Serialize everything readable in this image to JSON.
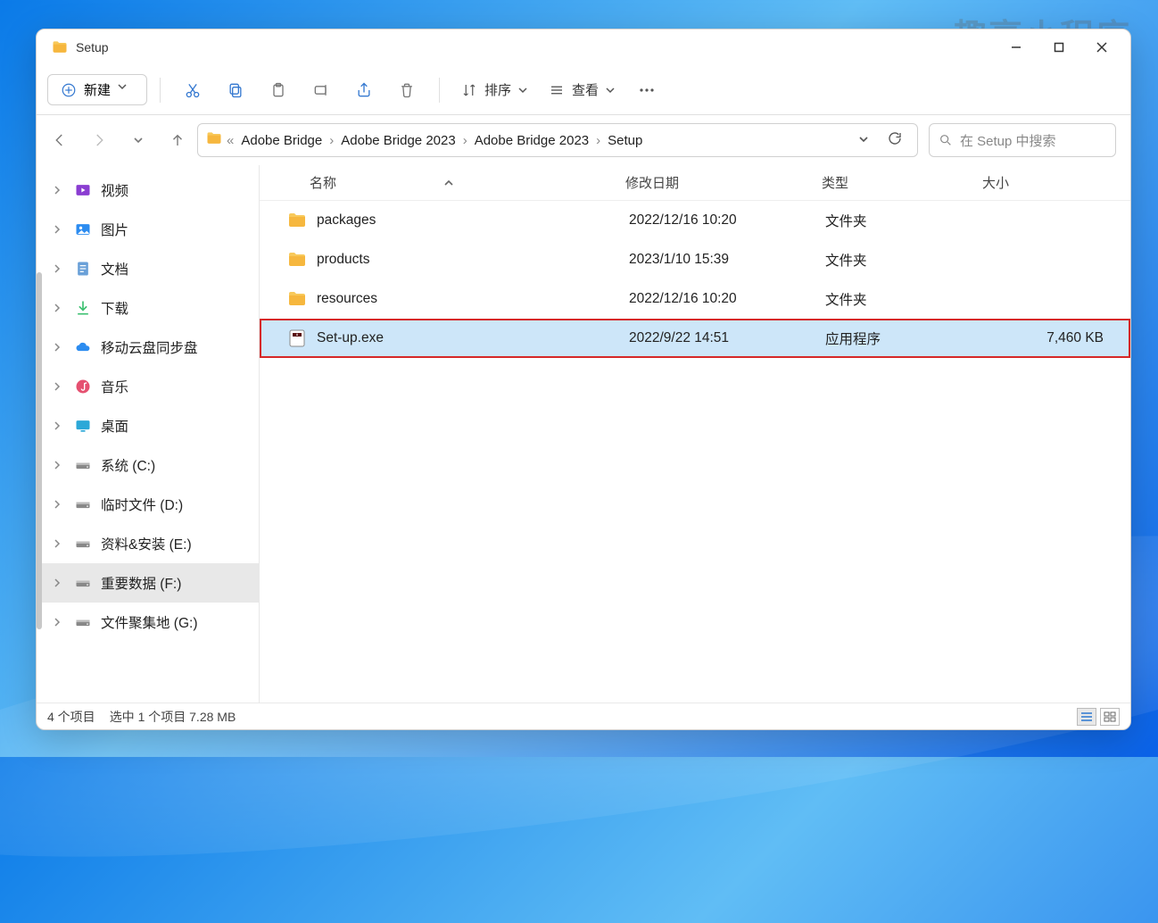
{
  "window_title": "Setup",
  "toolbar": {
    "new_label": "新建",
    "sort_label": "排序",
    "view_label": "查看"
  },
  "breadcrumb": [
    "Adobe Bridge",
    "Adobe Bridge 2023",
    "Adobe Bridge 2023",
    "Setup"
  ],
  "search_placeholder": "在 Setup 中搜索",
  "columns": {
    "name": "名称",
    "date": "修改日期",
    "type": "类型",
    "size": "大小"
  },
  "files": [
    {
      "icon": "folder",
      "name": "packages",
      "date": "2022/12/16 10:20",
      "type": "文件夹",
      "size": ""
    },
    {
      "icon": "folder",
      "name": "products",
      "date": "2023/1/10 15:39",
      "type": "文件夹",
      "size": ""
    },
    {
      "icon": "folder",
      "name": "resources",
      "date": "2022/12/16 10:20",
      "type": "文件夹",
      "size": ""
    },
    {
      "icon": "exe",
      "name": "Set-up.exe",
      "date": "2022/9/22 14:51",
      "type": "应用程序",
      "size": "7,460 KB",
      "selected": true
    }
  ],
  "sidebar": [
    {
      "icon": "video",
      "label": "视频",
      "color": "#8a3dd1"
    },
    {
      "icon": "picture",
      "label": "图片",
      "color": "#2c8cf0"
    },
    {
      "icon": "doc",
      "label": "文档",
      "color": "#6aa0d8"
    },
    {
      "icon": "download",
      "label": "下载",
      "color": "#3cc070"
    },
    {
      "icon": "cloud",
      "label": "移动云盘同步盘",
      "color": "#2c8cf0"
    },
    {
      "icon": "music",
      "label": "音乐",
      "color": "#e55070"
    },
    {
      "icon": "desktop",
      "label": "桌面",
      "color": "#2ca8d8"
    },
    {
      "icon": "drive",
      "label": "系统 (C:)",
      "color": "#555"
    },
    {
      "icon": "drive",
      "label": "临时文件 (D:)",
      "color": "#555"
    },
    {
      "icon": "drive",
      "label": "资料&安装 (E:)",
      "color": "#555"
    },
    {
      "icon": "drive",
      "label": "重要数据 (F:)",
      "color": "#555",
      "selected": true
    },
    {
      "icon": "drive",
      "label": "文件聚集地 (G:)",
      "color": "#555"
    }
  ],
  "status": {
    "count": "4 个项目",
    "selected": "选中 1 个项目  7.28 MB"
  },
  "watermark": "趣享小程序"
}
